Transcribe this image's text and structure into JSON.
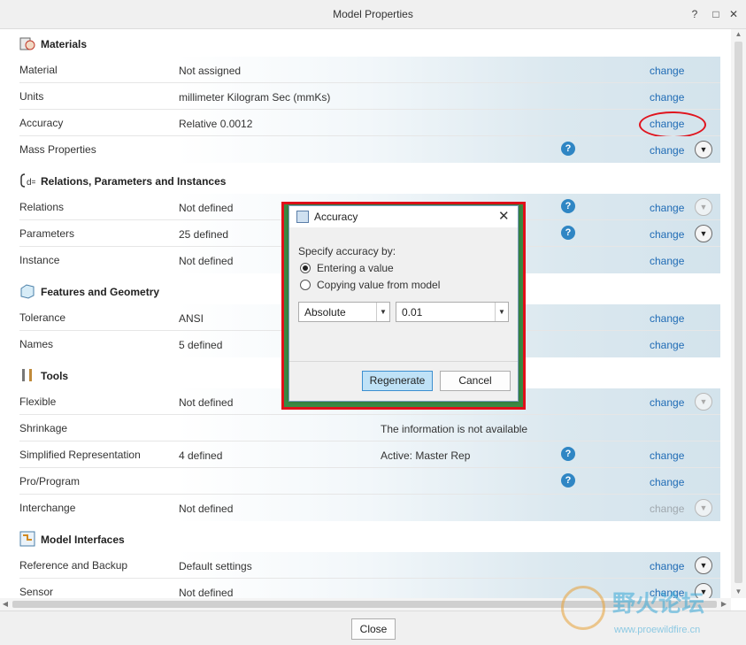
{
  "window": {
    "title": "Model Properties",
    "close_button": "Close"
  },
  "sections": {
    "materials": "Materials",
    "relations": "Relations, Parameters and Instances",
    "features": "Features and Geometry",
    "tools": "Tools",
    "interfaces": "Model Interfaces"
  },
  "rows": {
    "material": {
      "label": "Material",
      "value": "Not assigned",
      "link": "change"
    },
    "units": {
      "label": "Units",
      "value": "millimeter Kilogram Sec (mmKs)",
      "link": "change"
    },
    "accuracy": {
      "label": "Accuracy",
      "value": "Relative 0.0012",
      "link": "change"
    },
    "mass": {
      "label": "Mass Properties",
      "value": "",
      "link": "change"
    },
    "relations": {
      "label": "Relations",
      "value": "Not defined",
      "link": "change"
    },
    "parameters": {
      "label": "Parameters",
      "value": "25 defined",
      "link": "change"
    },
    "instance": {
      "label": "Instance",
      "value": "Not defined",
      "link": "change"
    },
    "tolerance": {
      "label": "Tolerance",
      "value": "ANSI",
      "link": "change"
    },
    "names": {
      "label": "Names",
      "value": "5 defined",
      "link": "change"
    },
    "flexible": {
      "label": "Flexible",
      "value": "Not defined",
      "link": "change"
    },
    "shrinkage": {
      "label": "Shrinkage",
      "value": "",
      "info": "The information is not available"
    },
    "simplified": {
      "label": "Simplified Representation",
      "value": "4 defined",
      "info": "Active: Master Rep",
      "link": "change"
    },
    "proprogram": {
      "label": "Pro/Program",
      "value": "",
      "link": "change"
    },
    "interchange": {
      "label": "Interchange",
      "value": "Not defined",
      "link": "change"
    },
    "reference": {
      "label": "Reference and Backup",
      "value": "Default settings",
      "link": "change"
    },
    "sensor": {
      "label": "Sensor",
      "value": "Not defined",
      "link": "change"
    }
  },
  "dialog": {
    "title": "Accuracy",
    "prompt": "Specify accuracy by:",
    "option1": "Entering a value",
    "option2": "Copying value from model",
    "type_select": "Absolute",
    "value_input": "0.01",
    "regenerate": "Regenerate",
    "cancel": "Cancel"
  },
  "watermark": {
    "text": "野火论坛",
    "url": "www.proewildfire.cn"
  },
  "colors": {
    "link": "#1f6bb5",
    "highlight": "#e1101a",
    "help": "#2f86c4"
  }
}
